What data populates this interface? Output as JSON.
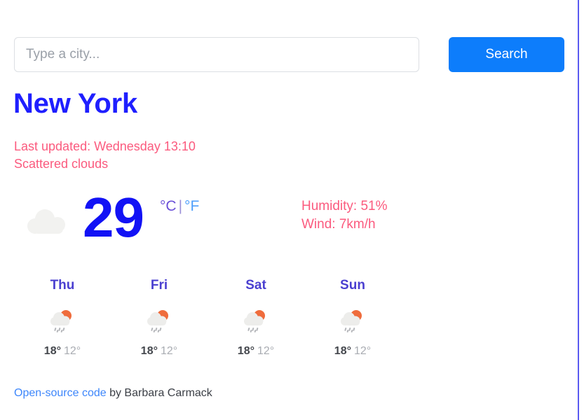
{
  "search": {
    "placeholder": "Type a city...",
    "value": "",
    "button_label": "Search"
  },
  "current": {
    "city": "New York",
    "last_updated": "Last updated: Wednesday 13:10",
    "description": "Scattered clouds",
    "temperature": "29",
    "unit_celsius": "°C",
    "unit_separator": "|",
    "unit_fahrenheit": "°F",
    "humidity": "Humidity: 51%",
    "wind": "Wind: 7km/h",
    "icon": "cloud-icon"
  },
  "forecast": [
    {
      "day": "Thu",
      "icon": "sun-rain-cloud-icon",
      "temp_max": "18°",
      "temp_min": "12°"
    },
    {
      "day": "Fri",
      "icon": "sun-rain-cloud-icon",
      "temp_max": "18°",
      "temp_min": "12°"
    },
    {
      "day": "Sat",
      "icon": "sun-rain-cloud-icon",
      "temp_max": "18°",
      "temp_min": "12°"
    },
    {
      "day": "Sun",
      "icon": "sun-rain-cloud-icon",
      "temp_max": "18°",
      "temp_min": "12°"
    }
  ],
  "footer": {
    "link_label": "Open-source code",
    "attribution": " by Barbara Carmack"
  },
  "colors": {
    "accent_blue": "#0d7dfb",
    "city_blue": "#1f1fff",
    "temp_blue": "#1212f5",
    "meta_pink": "#fb5a7e",
    "day_purple": "#4a3fd0",
    "cloud_gray": "#f2f2f0",
    "sun_orange": "#ef6c3c"
  }
}
